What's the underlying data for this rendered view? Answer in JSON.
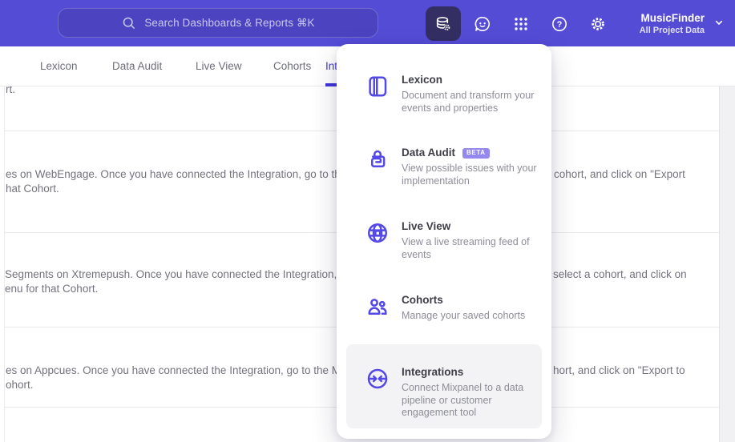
{
  "header": {
    "search": {
      "placeholder": "Search Dashboards & Reports ⌘K"
    },
    "project": {
      "name": "MusicFinder",
      "scope": "All Project Data"
    },
    "icons": [
      "database-gear-icon",
      "support-chat-icon",
      "apps-grid-icon",
      "help-icon",
      "settings-gear-icon",
      "chevron-down-icon"
    ]
  },
  "tabs": [
    {
      "label": "Lexicon"
    },
    {
      "label": "Data Audit"
    },
    {
      "label": "Live View"
    },
    {
      "label": "Cohorts"
    },
    {
      "label": "Integrations",
      "active": true
    }
  ],
  "menu": {
    "items": [
      {
        "title": "Lexicon",
        "icon": "book-icon",
        "description": "Document and transform your events and properties"
      },
      {
        "title": "Data Audit",
        "icon": "audit-lock-icon",
        "badge": "BETA",
        "description": "View possible issues with your implementation"
      },
      {
        "title": "Live View",
        "icon": "globe-icon",
        "description": "View a live streaming feed of events"
      },
      {
        "title": "Cohorts",
        "icon": "people-icon",
        "description": "Manage your saved cohorts"
      },
      {
        "title": "Integrations",
        "icon": "sync-arrows-icon",
        "highlighted": true,
        "description": "Connect Mixpanel to a data pipeline or customer engagement tool"
      }
    ]
  },
  "content": {
    "rows": [
      {
        "line1_left": "rt.",
        "line1_right": "",
        "line2_left": ""
      },
      {
        "line1_left": "es on WebEngage. Once you have connected the Integration, go to the",
        "line1_right": "cohort, and click on \"Export",
        "line2_left": "hat Cohort."
      },
      {
        "line1_left": "Segments on Xtremepush. Once you have connected the Integration,",
        "line1_right": "select a cohort, and click on",
        "line2_left": "enu for that Cohort."
      },
      {
        "line1_left": "es on Appcues. Once you have connected the Integration, go to the M",
        "line1_right": "hort, and click on \"Export to",
        "line2_left": "ohort."
      }
    ]
  },
  "colors": {
    "header_bg": "#554CD6",
    "search_pill_bg": "#4B43C0",
    "active_icon_bg": "#332F63",
    "accent_indigo": "#5348E8",
    "tab_underline": "#4135D6",
    "beta_badge_bg": "#9488EE",
    "highlight_bg": "#F3F3F5",
    "body_text": "#73737D"
  }
}
